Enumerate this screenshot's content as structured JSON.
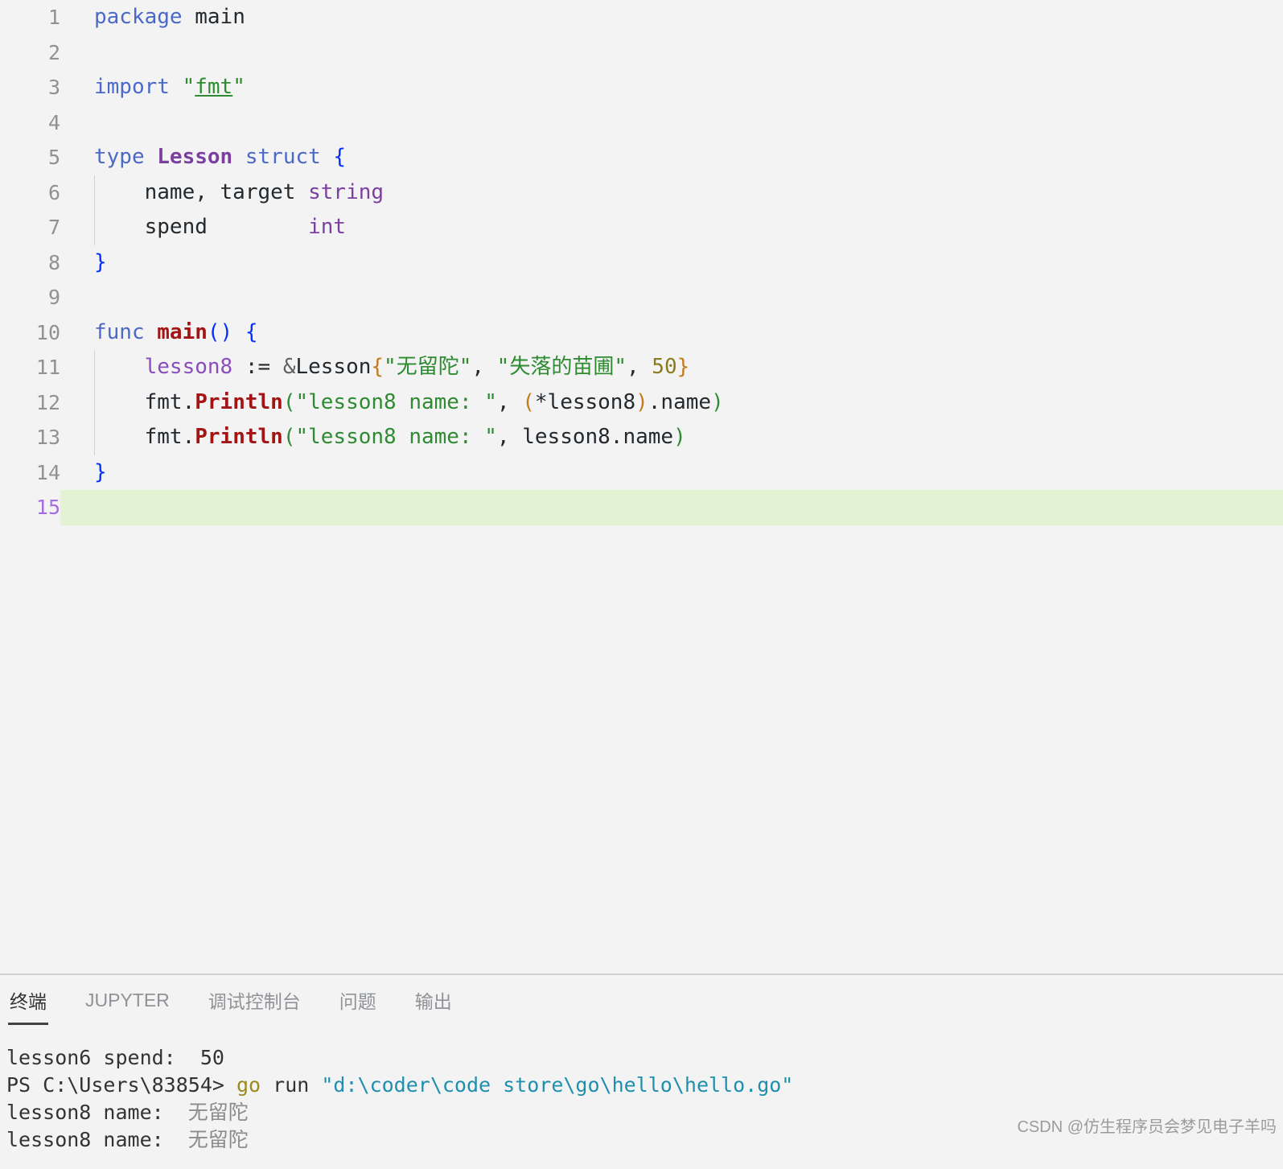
{
  "editor": {
    "language": "go",
    "active_line": 15,
    "active_line_highlight_color": "#e3f2d3",
    "background_color": "#f3f3f3",
    "lines": [
      {
        "number": "1",
        "text": "package main"
      },
      {
        "number": "2",
        "text": ""
      },
      {
        "number": "3",
        "text": "import \"fmt\""
      },
      {
        "number": "4",
        "text": ""
      },
      {
        "number": "5",
        "text": "type Lesson struct {"
      },
      {
        "number": "6",
        "text": "    name, target string"
      },
      {
        "number": "7",
        "text": "    spend        int"
      },
      {
        "number": "8",
        "text": "}"
      },
      {
        "number": "9",
        "text": ""
      },
      {
        "number": "10",
        "text": "func main() {"
      },
      {
        "number": "11",
        "text": "    lesson8 := &Lesson{\"无留陀\", \"失落的苗圃\", 50}"
      },
      {
        "number": "12",
        "text": "    fmt.Println(\"lesson8 name: \", (*lesson8).name)"
      },
      {
        "number": "13",
        "text": "    fmt.Println(\"lesson8 name: \", lesson8.name)"
      },
      {
        "number": "14",
        "text": "}"
      },
      {
        "number": "15",
        "text": ""
      }
    ],
    "tokens": {
      "l1_kw": "package",
      "l1_ident": " main",
      "l3_kw": "import",
      "l3_quote_open": " \"",
      "l3_link": "fmt",
      "l3_quote_close": "\"",
      "l5_kw_type": "type",
      "l5_name": " Lesson",
      "l5_kw_struct": " struct",
      "l5_brace": " {",
      "l6_fields": "    name, target ",
      "l6_type": "string",
      "l7_fields": "    spend        ",
      "l7_type": "int",
      "l8_brace": "}",
      "l10_kw": "func",
      "l10_fn": " main",
      "l10_parens": "()",
      "l10_brace": " {",
      "l11_var": "    lesson8",
      "l11_assign": " := ",
      "l11_amp": "&",
      "l11_struct": "Lesson",
      "l11_brace_open": "{",
      "l11_s1": "\"无留陀\"",
      "l11_comma1": ", ",
      "l11_s2": "\"失落的苗圃\"",
      "l11_comma2": ", ",
      "l11_num": "50",
      "l11_brace_close": "}",
      "l12_pkg": "    fmt",
      "l12_dot": ".",
      "l12_fn": "Println",
      "l12_paren_open": "(",
      "l12_str": "\"lesson8 name: \"",
      "l12_comma": ", ",
      "l12_paren2_open": "(",
      "l12_star_expr": "*lesson8",
      "l12_paren2_close": ")",
      "l12_field": ".name",
      "l12_paren_close": ")",
      "l13_pkg": "    fmt",
      "l13_dot": ".",
      "l13_fn": "Println",
      "l13_paren_open": "(",
      "l13_str": "\"lesson8 name: \"",
      "l13_comma": ", ",
      "l13_expr": "lesson8.name",
      "l13_paren_close": ")",
      "l14_brace": "}"
    }
  },
  "panel": {
    "tabs": [
      {
        "label": "终端",
        "active": true
      },
      {
        "label": "JUPYTER",
        "active": false
      },
      {
        "label": "调试控制台",
        "active": false
      },
      {
        "label": "问题",
        "active": false
      },
      {
        "label": "输出",
        "active": false
      }
    ],
    "terminal": {
      "line1": "lesson6 spend:  50",
      "line2_prompt": "PS C:\\Users\\83854> ",
      "line2_cmd": "go",
      "line2_args": " run ",
      "line2_path": "\"d:\\coder\\code store\\go\\hello\\hello.go\"",
      "line3_label": "lesson8 name:  ",
      "line3_value": "无留陀",
      "line4_label": "lesson8 name:  ",
      "line4_value": "无留陀"
    }
  },
  "watermark": {
    "text": "CSDN @仿生程序员会梦见电子羊吗"
  }
}
